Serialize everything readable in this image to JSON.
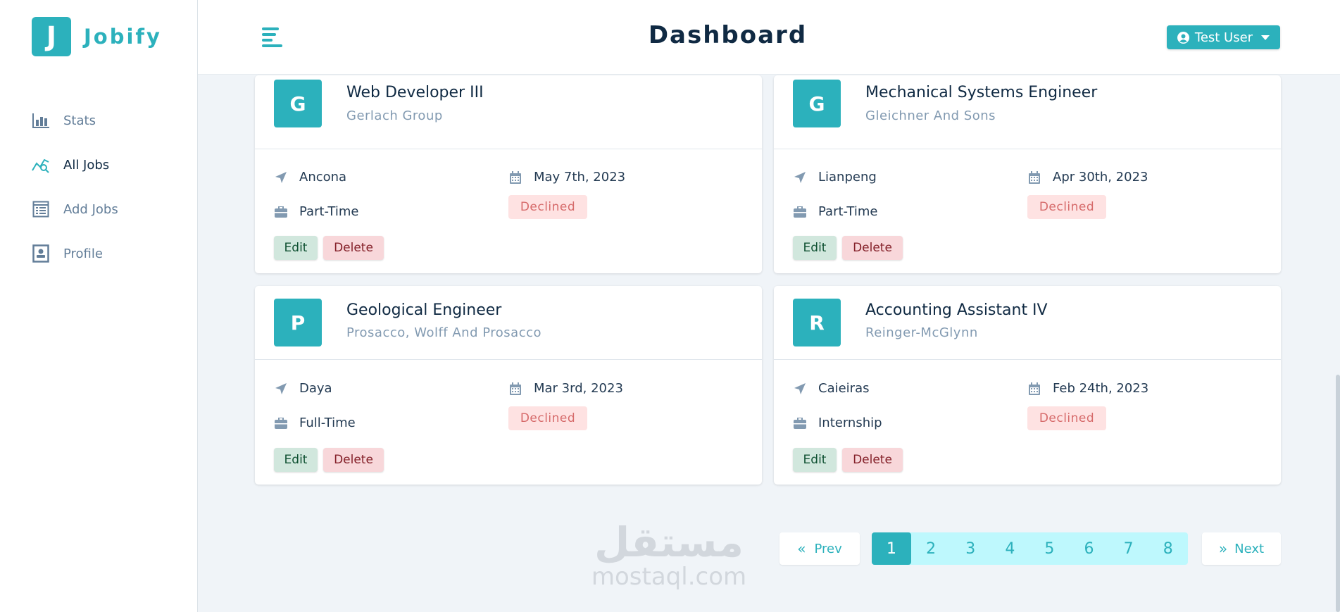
{
  "app": {
    "logo_letter": "J",
    "name": "Jobify",
    "brand_color": "#2cb1bc"
  },
  "sidebar": {
    "items": [
      {
        "label": "Stats",
        "icon": "stats-bar-chart-icon",
        "active": false
      },
      {
        "label": "All Jobs",
        "icon": "magnifying-chart-icon",
        "active": true
      },
      {
        "label": "Add Jobs",
        "icon": "form-list-icon",
        "active": false
      },
      {
        "label": "Profile",
        "icon": "id-card-icon",
        "active": false
      }
    ]
  },
  "header": {
    "title": "Dashboard",
    "user_label": "Test User",
    "toggle_icon": "menu-align-left-icon",
    "user_icon": "user-circle-icon"
  },
  "jobs": [
    {
      "letter": "G",
      "position": "Web Developer III",
      "company": "Gerlach Group",
      "location": "Ancona",
      "date": "May 7th, 2023",
      "type": "Part-Time",
      "status": "Declined",
      "edit": "Edit",
      "delete": "Delete"
    },
    {
      "letter": "G",
      "position": "Mechanical Systems Engineer",
      "company": "Gleichner And Sons",
      "location": "Lianpeng",
      "date": "Apr 30th, 2023",
      "type": "Part-Time",
      "status": "Declined",
      "edit": "Edit",
      "delete": "Delete"
    },
    {
      "letter": "P",
      "position": "Geological Engineer",
      "company": "Prosacco, Wolff And Prosacco",
      "location": "Daya",
      "date": "Mar 3rd, 2023",
      "type": "Full-Time",
      "status": "Declined",
      "edit": "Edit",
      "delete": "Delete"
    },
    {
      "letter": "R",
      "position": "Accounting Assistant IV",
      "company": "Reinger-McGlynn",
      "location": "Caieiras",
      "date": "Feb 24th, 2023",
      "type": "Internship",
      "status": "Declined",
      "edit": "Edit",
      "delete": "Delete"
    }
  ],
  "pagination": {
    "prev": "Prev",
    "next": "Next",
    "pages": [
      "1",
      "2",
      "3",
      "4",
      "5",
      "6",
      "7",
      "8"
    ],
    "current": "1"
  },
  "watermark": {
    "arabic": "مستقل",
    "latin": "mostaql.com"
  }
}
